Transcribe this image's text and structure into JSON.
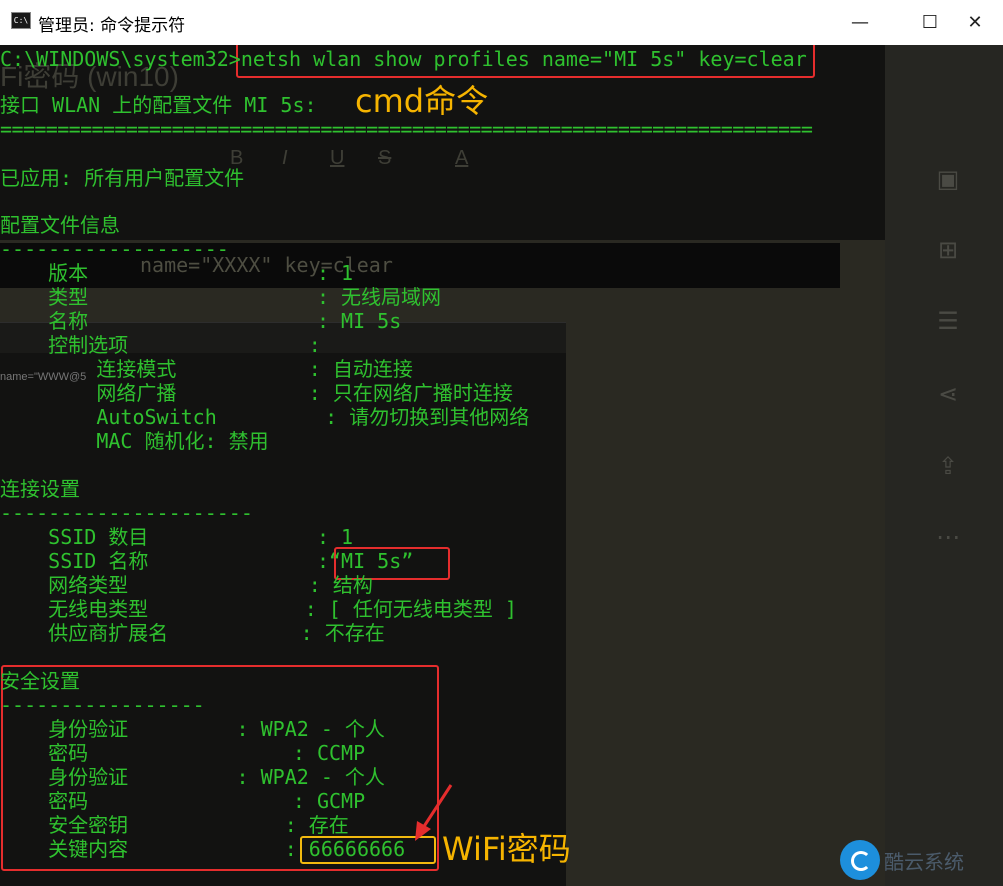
{
  "window": {
    "icon_text": "C:\\",
    "title": "管理员: 命令提示符",
    "minimize_glyph": "—",
    "maximize_glyph": "☐",
    "close_glyph": "✕"
  },
  "terminal": {
    "command_line": "C:\\WINDOWS\\system32>netsh wlan show profiles name=\"MI 5s\" key=clear",
    "header": "接口 WLAN 上的配置文件 MI 5s:",
    "separator": "=======================================================================",
    "applied": "已应用: 所有用户配置文件",
    "profile_info_title": "配置文件信息",
    "profile_info_dash": "-------------------",
    "profile_rows": [
      "    版本                   : 1",
      "    类型                   : 无线局域网",
      "    名称                   : MI 5s",
      "    控制选项               :",
      "        连接模式           : 自动连接",
      "        网络广播           : 只在网络广播时连接",
      "        AutoSwitch         : 请勿切换到其他网络",
      "        MAC 随机化: 禁用"
    ],
    "conn_title": "连接设置",
    "conn_dash": "---------------------",
    "conn_rows": [
      "    SSID 数目              : 1",
      "    SSID 名称              :“MI 5s”",
      "    网络类型               : 结构",
      "    无线电类型             : [ 任何无线电类型 ]",
      "    供应商扩展名           : 不存在"
    ],
    "sec_title": "安全设置",
    "sec_dash": "-----------------",
    "sec_rows": [
      "    身份验证         : WPA2 - 个人",
      "    密码                 : CCMP",
      "    身份验证         : WPA2 - 个人",
      "    密码                 : GCMP",
      "    安全密钥             : 存在",
      "    关键内容             : 66666666"
    ]
  },
  "annotations": {
    "cmd_label": "cmd命令",
    "wifi_label": "WiFi密码"
  },
  "background": {
    "ghost_heading": "Fi密码 (win10)",
    "ghost_cmd": "name=\"XXXX\" key=clear",
    "ghost_small": "name=\"WWW@5",
    "toolbar_items": [
      "B",
      "I",
      "U",
      "S",
      "A"
    ],
    "logo_text": "酷云系统"
  },
  "colors": {
    "terminal_bg": "#121211",
    "terminal_text": "#2fc12f",
    "highlight_red": "#e52d2d",
    "annotation_yellow": "#f6b400"
  }
}
